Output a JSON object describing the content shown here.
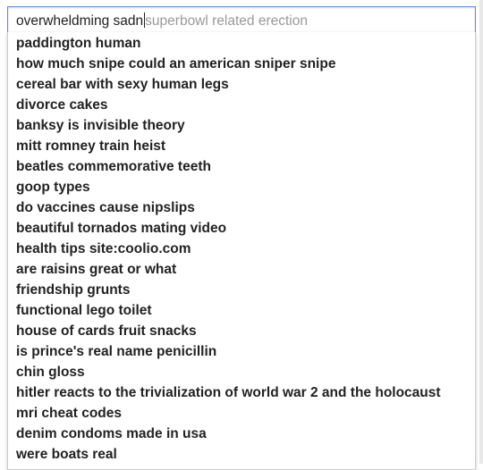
{
  "search": {
    "typed_text": "overwheldming sadn",
    "autocomplete_ghost": "superbowl related erection"
  },
  "suggestions": [
    "paddington human",
    "how much snipe could an american sniper snipe",
    "cereal bar with sexy human legs",
    "divorce cakes",
    "banksy is invisible theory",
    "mitt romney train heist",
    "beatles commemorative teeth",
    "goop types",
    "do vaccines cause nipslips",
    "beautiful tornados mating video",
    "health tips site:coolio.com",
    "are raisins great or what",
    "friendship grunts",
    "functional lego toilet",
    "house of cards fruit snacks",
    "is prince's real name penicillin",
    "chin gloss",
    "hitler reacts to the trivialization of world war 2 and the holocaust",
    "mri cheat codes",
    "denim condoms made in usa",
    "were boats real"
  ]
}
